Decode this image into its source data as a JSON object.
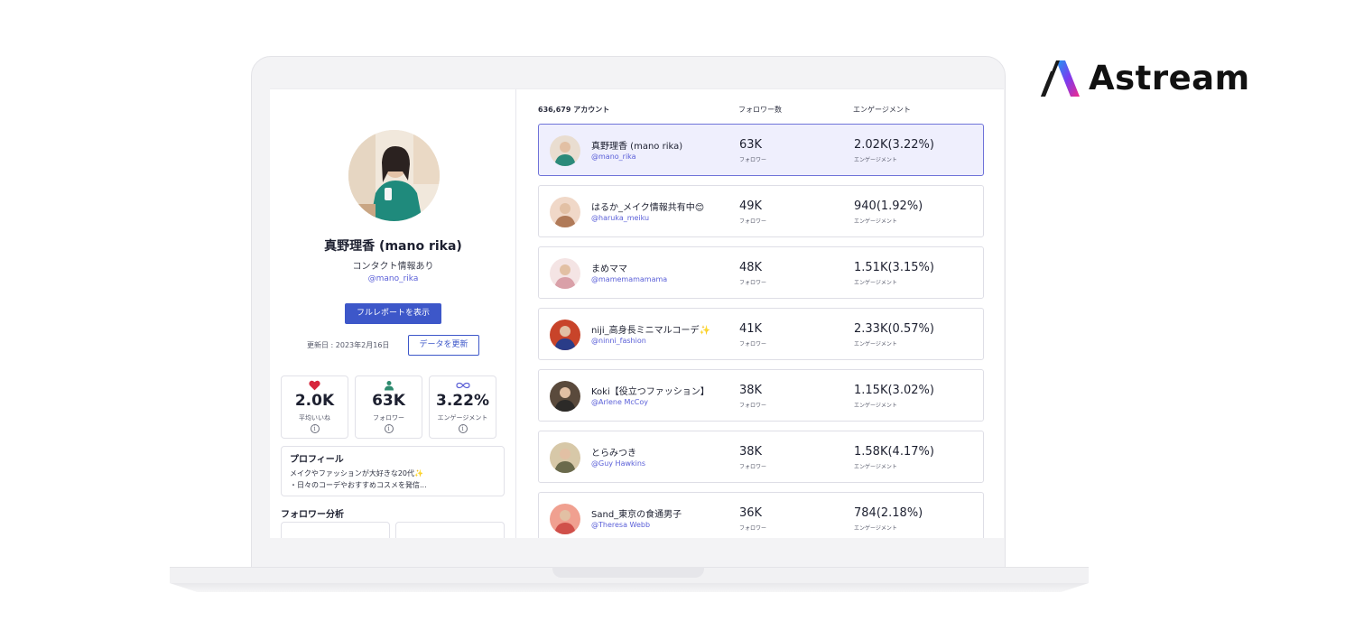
{
  "brand": {
    "name": "Astream"
  },
  "profile": {
    "name": "真野理香 (mano rika)",
    "contact": "コンタクト情報あり",
    "handle": "@mano_rika",
    "report_button": "フルレポートを表示",
    "updated": "更新日 : 2023年2月16日",
    "update_button": "データを更新",
    "stats": [
      {
        "value": "2.0K",
        "label": "平均いいね",
        "icon": "heart-icon"
      },
      {
        "value": "63K",
        "label": "フォロワー",
        "icon": "person-icon"
      },
      {
        "value": "3.22%",
        "label": "エンゲージメント",
        "icon": "infinity-icon"
      }
    ],
    "info_glyph": "i",
    "bio_title": "プロフィール",
    "bio_line1": "メイクやファッションが大好きな20代✨",
    "bio_line2": "・日々のコーデやおすすめコスメを発信...",
    "follower_analysis": "フォロワー分析"
  },
  "list": {
    "count_header": "636,679 アカウント",
    "follower_header": "フォロワー数",
    "engagement_header": "エンゲージメント",
    "follower_sub": "フォロワー",
    "engagement_sub": "エンゲージメント",
    "rows": [
      {
        "name": "真野理香 (mano rika)",
        "handle": "@mano_rika",
        "followers": "63K",
        "engagement": "2.02K(3.22%)",
        "selected": true,
        "colors": [
          "#e9ddd0",
          "#2b8a7a"
        ]
      },
      {
        "name": "はるか_メイク情報共有中😊",
        "handle": "@haruka_meiku",
        "followers": "49K",
        "engagement": "940(1.92%)",
        "selected": false,
        "colors": [
          "#f0d8c8",
          "#b07a58"
        ]
      },
      {
        "name": "まめママ",
        "handle": "@mamemamamama",
        "followers": "48K",
        "engagement": "1.51K(3.15%)",
        "selected": false,
        "colors": [
          "#f4e4e4",
          "#d9a0a8"
        ]
      },
      {
        "name": "niji_高身長ミニマルコーデ✨",
        "handle": "@ninni_fashion",
        "followers": "41K",
        "engagement": "2.33K(0.57%)",
        "selected": false,
        "colors": [
          "#c8442a",
          "#2a3c88"
        ]
      },
      {
        "name": "Koki【役立つファッション】",
        "handle": "@Arlene McCoy",
        "followers": "38K",
        "engagement": "1.15K(3.02%)",
        "selected": false,
        "colors": [
          "#5a4a3c",
          "#2c2a28"
        ]
      },
      {
        "name": "とらみつき",
        "handle": "@Guy Hawkins",
        "followers": "38K",
        "engagement": "1.58K(4.17%)",
        "selected": false,
        "colors": [
          "#d7c8a8",
          "#6a6a4c"
        ]
      },
      {
        "name": "Sand_東京の食通男子",
        "handle": "@Theresa Webb",
        "followers": "36K",
        "engagement": "784(2.18%)",
        "selected": false,
        "colors": [
          "#f0a090",
          "#d0504a"
        ]
      }
    ]
  }
}
